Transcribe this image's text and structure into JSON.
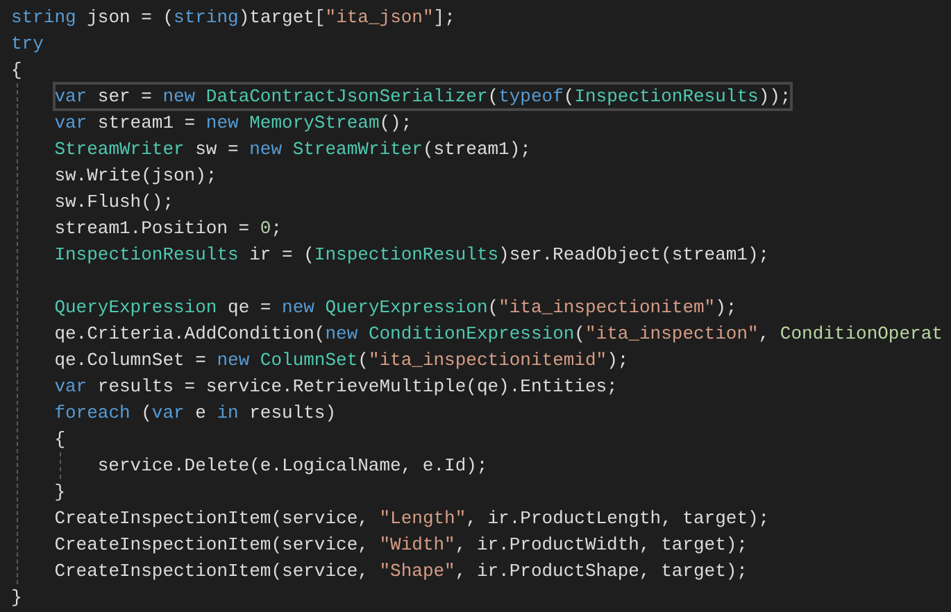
{
  "editor": {
    "lines": [
      {
        "kind": "line",
        "tokens": [
          {
            "kind": "keyword",
            "text": "string"
          },
          {
            "kind": "plain",
            "text": " json = ("
          },
          {
            "kind": "keyword",
            "text": "string"
          },
          {
            "kind": "plain",
            "text": ")target["
          },
          {
            "kind": "string",
            "text": "\"ita_json\""
          },
          {
            "kind": "plain",
            "text": "];"
          }
        ]
      },
      {
        "kind": "line",
        "tokens": [
          {
            "kind": "keyword",
            "text": "try"
          }
        ]
      },
      {
        "kind": "line",
        "tokens": [
          {
            "kind": "plain",
            "text": "{"
          }
        ]
      },
      {
        "kind": "block",
        "children": [
          {
            "kind": "line",
            "current": true,
            "tokens": [
              {
                "kind": "keyword",
                "text": "var"
              },
              {
                "kind": "plain",
                "text": " ser = "
              },
              {
                "kind": "keyword",
                "text": "new"
              },
              {
                "kind": "type",
                "text": " DataContractJsonSerializer"
              },
              {
                "kind": "plain",
                "text": "("
              },
              {
                "kind": "keyword",
                "text": "typeof"
              },
              {
                "kind": "plain",
                "text": "("
              },
              {
                "kind": "type",
                "text": "InspectionResults"
              },
              {
                "kind": "plain",
                "text": "));"
              }
            ]
          },
          {
            "kind": "line",
            "tokens": [
              {
                "kind": "keyword",
                "text": "var"
              },
              {
                "kind": "plain",
                "text": " stream1 = "
              },
              {
                "kind": "keyword",
                "text": "new"
              },
              {
                "kind": "type",
                "text": " MemoryStream"
              },
              {
                "kind": "plain",
                "text": "();"
              }
            ]
          },
          {
            "kind": "line",
            "tokens": [
              {
                "kind": "type",
                "text": "StreamWriter"
              },
              {
                "kind": "plain",
                "text": " sw = "
              },
              {
                "kind": "keyword",
                "text": "new"
              },
              {
                "kind": "type",
                "text": " StreamWriter"
              },
              {
                "kind": "plain",
                "text": "(stream1);"
              }
            ]
          },
          {
            "kind": "line",
            "tokens": [
              {
                "kind": "plain",
                "text": "sw.Write(json);"
              }
            ]
          },
          {
            "kind": "line",
            "tokens": [
              {
                "kind": "plain",
                "text": "sw.Flush();"
              }
            ]
          },
          {
            "kind": "line",
            "tokens": [
              {
                "kind": "plain",
                "text": "stream1.Position = "
              },
              {
                "kind": "number",
                "text": "0"
              },
              {
                "kind": "plain",
                "text": ";"
              }
            ]
          },
          {
            "kind": "line",
            "tokens": [
              {
                "kind": "type",
                "text": "InspectionResults"
              },
              {
                "kind": "plain",
                "text": " ir = ("
              },
              {
                "kind": "type",
                "text": "InspectionResults"
              },
              {
                "kind": "plain",
                "text": ")ser.ReadObject(stream1);"
              }
            ]
          },
          {
            "kind": "blank"
          },
          {
            "kind": "line",
            "tokens": [
              {
                "kind": "type",
                "text": "QueryExpression"
              },
              {
                "kind": "plain",
                "text": " qe = "
              },
              {
                "kind": "keyword",
                "text": "new"
              },
              {
                "kind": "type",
                "text": " QueryExpression"
              },
              {
                "kind": "plain",
                "text": "("
              },
              {
                "kind": "string",
                "text": "\"ita_inspectionitem\""
              },
              {
                "kind": "plain",
                "text": ");"
              }
            ]
          },
          {
            "kind": "line",
            "tokens": [
              {
                "kind": "plain",
                "text": "qe.Criteria.AddCondition("
              },
              {
                "kind": "keyword",
                "text": "new"
              },
              {
                "kind": "type",
                "text": " ConditionExpression"
              },
              {
                "kind": "plain",
                "text": "("
              },
              {
                "kind": "string",
                "text": "\"ita_inspection\""
              },
              {
                "kind": "plain",
                "text": ", "
              },
              {
                "kind": "enum",
                "text": "ConditionOperat"
              }
            ]
          },
          {
            "kind": "line",
            "tokens": [
              {
                "kind": "plain",
                "text": "qe.ColumnSet = "
              },
              {
                "kind": "keyword",
                "text": "new"
              },
              {
                "kind": "type",
                "text": " ColumnSet"
              },
              {
                "kind": "plain",
                "text": "("
              },
              {
                "kind": "string",
                "text": "\"ita_inspectionitemid\""
              },
              {
                "kind": "plain",
                "text": ");"
              }
            ]
          },
          {
            "kind": "line",
            "tokens": [
              {
                "kind": "keyword",
                "text": "var"
              },
              {
                "kind": "plain",
                "text": " results = service.RetrieveMultiple(qe).Entities;"
              }
            ]
          },
          {
            "kind": "line",
            "tokens": [
              {
                "kind": "keyword",
                "text": "foreach"
              },
              {
                "kind": "plain",
                "text": " ("
              },
              {
                "kind": "keyword",
                "text": "var"
              },
              {
                "kind": "plain",
                "text": " e "
              },
              {
                "kind": "keyword",
                "text": "in"
              },
              {
                "kind": "plain",
                "text": " results)"
              }
            ]
          },
          {
            "kind": "line",
            "tokens": [
              {
                "kind": "plain",
                "text": "{"
              }
            ]
          },
          {
            "kind": "block",
            "children": [
              {
                "kind": "line",
                "tokens": [
                  {
                    "kind": "plain",
                    "text": "service.Delete(e.LogicalName, e.Id);"
                  }
                ]
              }
            ]
          },
          {
            "kind": "line",
            "tokens": [
              {
                "kind": "plain",
                "text": "}"
              }
            ]
          },
          {
            "kind": "line",
            "tokens": [
              {
                "kind": "plain",
                "text": "CreateInspectionItem(service, "
              },
              {
                "kind": "string",
                "text": "\"Length\""
              },
              {
                "kind": "plain",
                "text": ", ir.ProductLength, target);"
              }
            ]
          },
          {
            "kind": "line",
            "tokens": [
              {
                "kind": "plain",
                "text": "CreateInspectionItem(service, "
              },
              {
                "kind": "string",
                "text": "\"Width\""
              },
              {
                "kind": "plain",
                "text": ", ir.ProductWidth, target);"
              }
            ]
          },
          {
            "kind": "line",
            "tokens": [
              {
                "kind": "plain",
                "text": "CreateInspectionItem(service, "
              },
              {
                "kind": "string",
                "text": "\"Shape\""
              },
              {
                "kind": "plain",
                "text": ", ir.ProductShape, target);"
              }
            ]
          }
        ]
      },
      {
        "kind": "line",
        "tokens": [
          {
            "kind": "plain",
            "text": "}"
          }
        ]
      }
    ]
  }
}
